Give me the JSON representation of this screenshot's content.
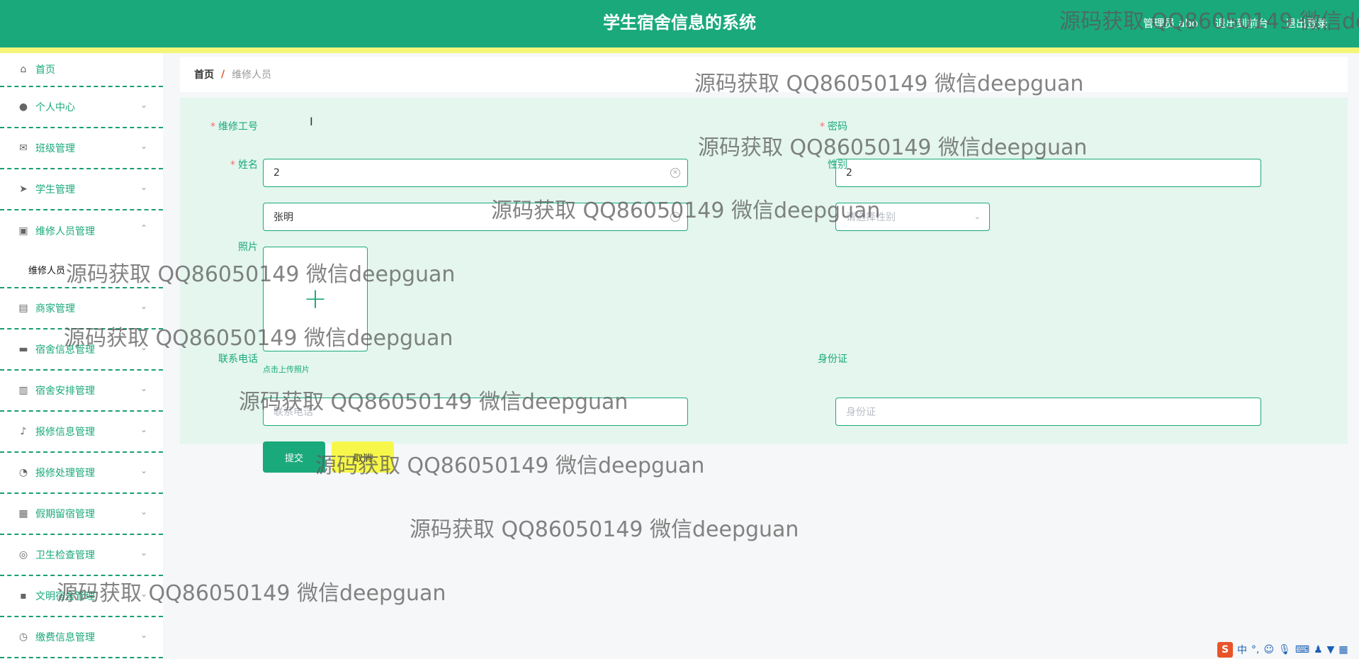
{
  "app": {
    "title": "学生宿舍信息的系统"
  },
  "top_links": [
    "管理员 abo",
    "退出到前台",
    "退出登录"
  ],
  "sidebar": {
    "items": [
      {
        "label": "首页",
        "icon": "home-icon"
      },
      {
        "label": "个人中心",
        "icon": "user-icon"
      },
      {
        "label": "班级管理",
        "icon": "mail-icon"
      },
      {
        "label": "学生管理",
        "icon": "send-icon"
      },
      {
        "label": "维修人员管理",
        "icon": "clipboard-icon",
        "expanded": true
      },
      {
        "label": "维修人员",
        "sub": true
      },
      {
        "label": "商家管理",
        "icon": "card-icon"
      },
      {
        "label": "宿舍信息管理",
        "icon": "briefcase-icon"
      },
      {
        "label": "宿舍安排管理",
        "icon": "document-icon"
      },
      {
        "label": "报修信息管理",
        "icon": "bell-off-icon"
      },
      {
        "label": "报修处理管理",
        "icon": "gauge-icon"
      },
      {
        "label": "假期留宿管理",
        "icon": "grid-icon"
      },
      {
        "label": "卫生检查管理",
        "icon": "lifebuoy-icon"
      },
      {
        "label": "文明宿舍管理",
        "icon": "chat-icon"
      },
      {
        "label": "缴费信息管理",
        "icon": "clock-icon"
      }
    ]
  },
  "breadcrumb": {
    "home": "首页",
    "separator": "/",
    "current": "维修人员"
  },
  "form": {
    "staff_no": {
      "label": "维修工号",
      "value": "2"
    },
    "password": {
      "label": "密码",
      "value": "2"
    },
    "name": {
      "label": "姓名",
      "value": "张明"
    },
    "gender": {
      "label": "性别",
      "placeholder": "请选择性别"
    },
    "photo": {
      "label": "照片",
      "hint": "点击上传照片"
    },
    "phone": {
      "label": "联系电话",
      "placeholder": "联系电话"
    },
    "id_card": {
      "label": "身份证",
      "placeholder": "身份证"
    },
    "submit_label": "提交",
    "cancel_label": "取消"
  },
  "watermark_text": "源码获取 QQ86050149 微信deepguan",
  "ime": {
    "logo": "S",
    "lang": "中"
  },
  "colors": {
    "primary": "#1aa97b",
    "accent_yellow": "#f7f74a",
    "required": "#f56c6c"
  }
}
